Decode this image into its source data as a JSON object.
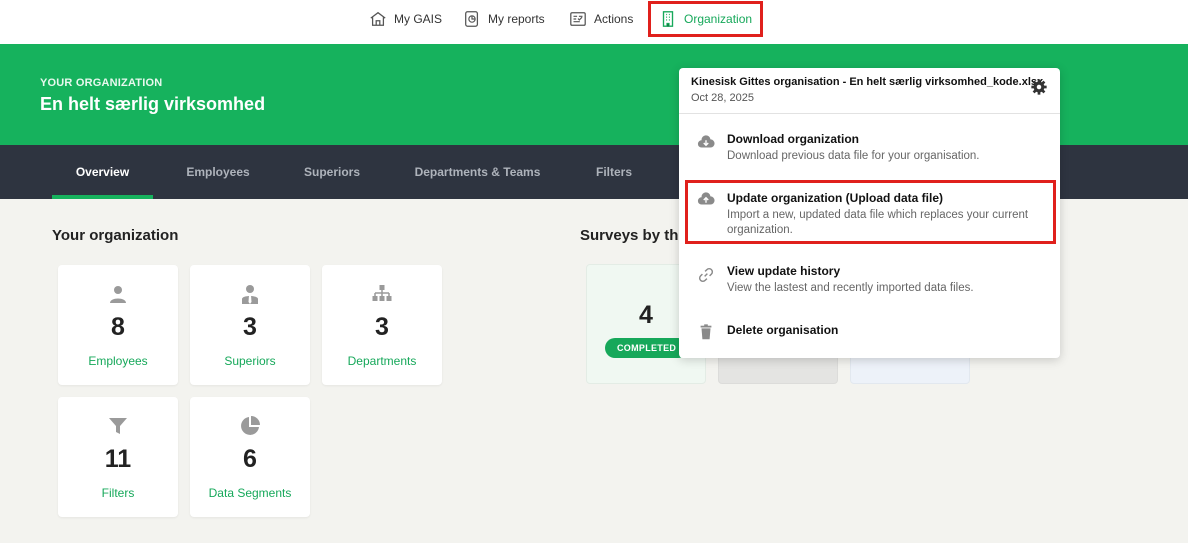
{
  "topnav": {
    "items": [
      {
        "label": "My GAIS",
        "icon": "house-icon"
      },
      {
        "label": "My reports",
        "icon": "reports-icon"
      },
      {
        "label": "Actions",
        "icon": "actions-icon"
      },
      {
        "label": "Organization",
        "icon": "building-icon"
      }
    ],
    "active_index": 3
  },
  "banner": {
    "kicker": "YOUR ORGANIZATION",
    "title": "En helt særlig virksomhed"
  },
  "tabs": {
    "items": [
      "Overview",
      "Employees",
      "Superiors",
      "Departments & Teams",
      "Filters"
    ],
    "active_index": 0
  },
  "org_section": {
    "title": "Your organization",
    "cards": [
      {
        "value": "8",
        "label": "Employees",
        "icon": "person-icon"
      },
      {
        "value": "3",
        "label": "Superiors",
        "icon": "superior-icon"
      },
      {
        "value": "3",
        "label": "Departments",
        "icon": "org-chart-icon"
      },
      {
        "value": "11",
        "label": "Filters",
        "icon": "funnel-icon"
      },
      {
        "value": "6",
        "label": "Data Segments",
        "icon": "pie-icon"
      }
    ]
  },
  "surveys_section": {
    "title": "Surveys by the",
    "cards": [
      {
        "value": "4",
        "badge": "COMPLETED"
      }
    ]
  },
  "popup": {
    "file_title": "Kinesisk Gittes organisation - En helt særlig virksomhed_kode.xlsx",
    "date": "Oct 28, 2025",
    "items": [
      {
        "title": "Download organization",
        "desc": "Download previous data file for your organisation.",
        "icon": "cloud-download-icon"
      },
      {
        "title": "Update organization (Upload data file)",
        "desc": "Import a new, updated data file which replaces your current organization.",
        "icon": "cloud-upload-icon"
      },
      {
        "title": "View update history",
        "desc": "View the lastest and recently imported data files.",
        "icon": "link-icon"
      },
      {
        "title": "Delete organisation",
        "desc": "",
        "icon": "trash-icon"
      }
    ]
  },
  "colors": {
    "brand_green": "#16b25d",
    "tab_bar": "#2e3440",
    "highlight_red": "#e0201c"
  }
}
